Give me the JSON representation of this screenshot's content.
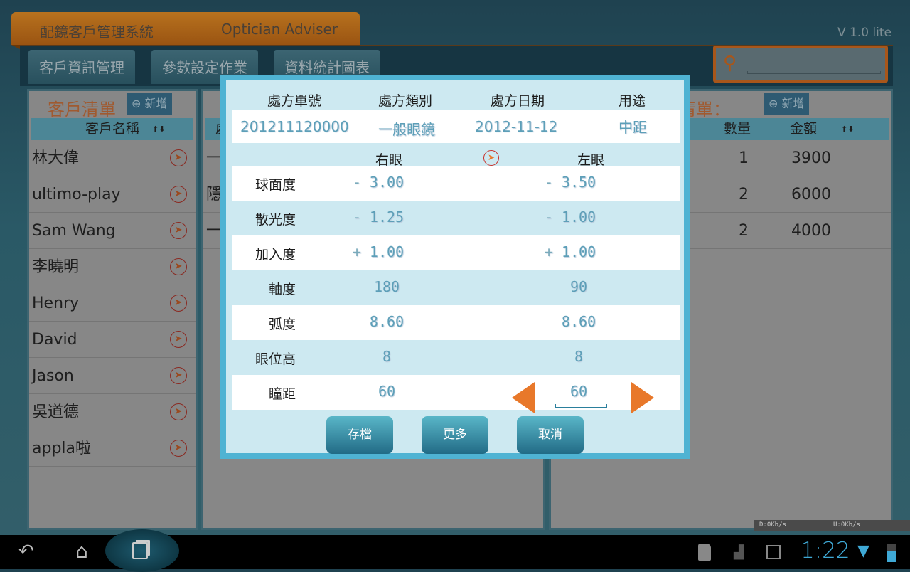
{
  "app": {
    "title_zh": "配鏡客戶管理系統",
    "title_en": "Optician Adviser",
    "version": "V 1.0 lite"
  },
  "nav": [
    "客戶資訊管理",
    "參數設定作業",
    "資料統計圖表"
  ],
  "search": {
    "value": ""
  },
  "customers": {
    "title": "客戶清單",
    "add_label": "新增",
    "column": "客戶名稱",
    "items": [
      "林大偉",
      "ultimo-play",
      "Sam Wang",
      "李曉明",
      "Henry",
      "David",
      "Jason",
      "吳道德",
      "appla啦"
    ]
  },
  "middle": {
    "header_partial": "處",
    "rows": [
      "一",
      "隱",
      "一"
    ]
  },
  "orders": {
    "title_partial": "清單：",
    "add_label": "新增",
    "columns": [
      "數量",
      "金額"
    ],
    "rows": [
      {
        "qty": "1",
        "amount": "3900"
      },
      {
        "qty": "2",
        "amount": "6000"
      },
      {
        "qty": "2",
        "amount": "4000"
      }
    ]
  },
  "dialog": {
    "headers": [
      "處方單號",
      "處方類別",
      "處方日期",
      "用途"
    ],
    "values": [
      "201211120000",
      "一般眼鏡",
      "2012-11-12",
      "中距"
    ],
    "right_eye": "右眼",
    "left_eye": "左眼",
    "rows": [
      {
        "label": "球面度",
        "right_sign": "-",
        "right": "3.00",
        "left_sign": "-",
        "left": "3.50"
      },
      {
        "label": "散光度",
        "right_sign": "-",
        "right": "1.25",
        "left_sign": "-",
        "left": "1.00"
      },
      {
        "label": "加入度",
        "right_sign": "+",
        "right": "1.00",
        "left_sign": "+",
        "left": "1.00"
      },
      {
        "label": "軸度",
        "right_sign": "",
        "right": "180",
        "left_sign": "",
        "left": "90"
      },
      {
        "label": "弧度",
        "right_sign": "",
        "right": "8.60",
        "left_sign": "",
        "left": "8.60"
      },
      {
        "label": "眼位高",
        "right_sign": "",
        "right": "8",
        "left_sign": "",
        "left": "8"
      },
      {
        "label": "瞳距",
        "right_sign": "",
        "right": "60",
        "left_sign": "",
        "left": "60"
      }
    ],
    "buttons": {
      "save": "存檔",
      "more": "更多",
      "cancel": "取消"
    }
  },
  "statusbar": {
    "time": "1:22",
    "down": "D:0Kb/s",
    "up": "U:0Kb/s"
  },
  "colors": {
    "accent_orange": "#e8782a",
    "dialog_border": "#4fb3d3",
    "value_blue": "#5d9fb8"
  }
}
